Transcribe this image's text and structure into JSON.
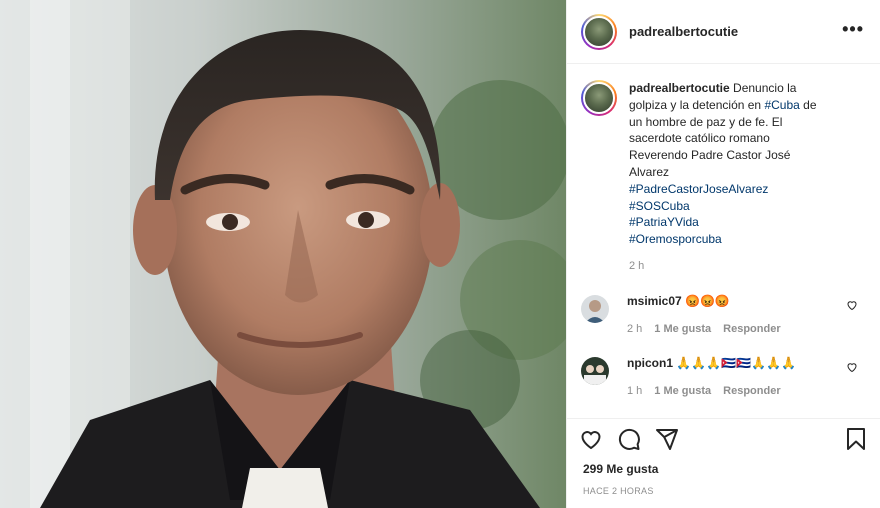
{
  "post": {
    "username": "padrealbertocutie",
    "more_icon": "more-horizontal-icon",
    "caption": {
      "username": "padrealbertocutie",
      "text_1": "Denuncio la golpiza y la detención en ",
      "hashtag_inline": "#Cuba",
      "text_2": " de un hombre de paz y de fe. El sacerdote católico romano Reverendo Padre Castor José Alvarez",
      "hashtags": [
        "#PadreCastorJoseAlvarez",
        "#SOSCuba",
        "#PatriaYVida",
        "#Oremosporcuba"
      ],
      "time": "2 h"
    },
    "comments": [
      {
        "username": "msimic07",
        "text": "😡😡😡",
        "time": "2 h",
        "likes_label": "1 Me gusta",
        "reply_label": "Responder"
      },
      {
        "username": "npicon1",
        "text": "🙏🙏🙏🇨🇺🇨🇺🙏🙏🙏",
        "time": "1 h",
        "likes_label": "1 Me gusta",
        "reply_label": "Responder"
      }
    ],
    "likes": "299 Me gusta",
    "posted_ago": "HACE 2 HORAS",
    "colors": {
      "link": "#00376b",
      "muted": "#8e8e8e",
      "text": "#262626",
      "border": "#efefef"
    }
  }
}
